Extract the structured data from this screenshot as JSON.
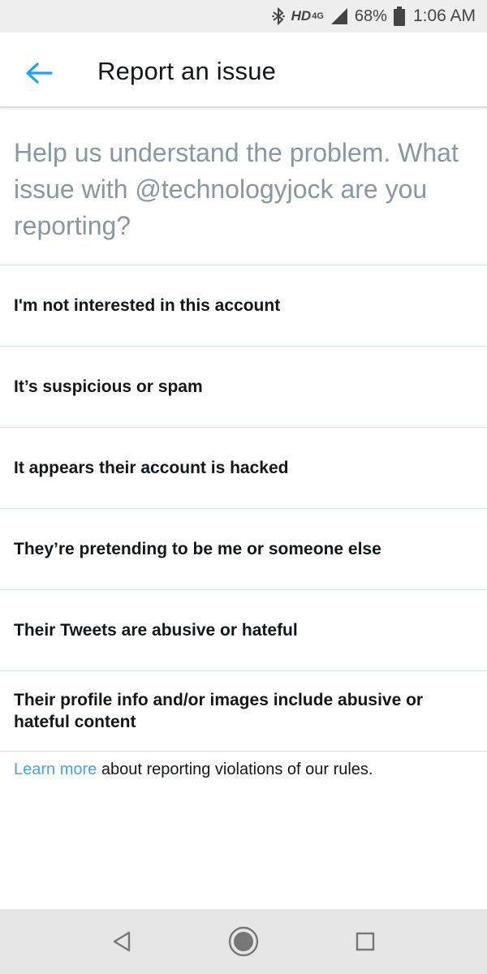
{
  "status_bar": {
    "network": "HD",
    "network_type": "4G",
    "battery": "68%",
    "time": "1:06 AM",
    "icons": [
      "bluetooth-icon",
      "signal-icon",
      "battery-icon"
    ]
  },
  "header": {
    "title": "Report an issue",
    "back_icon": "arrow-left-icon",
    "accent_color": "#1da1f2"
  },
  "prompt": "Help us understand the problem. What issue with @technologyjock are you reporting?",
  "options": [
    {
      "label": "I'm not interested in this account"
    },
    {
      "label": "It’s suspicious or spam"
    },
    {
      "label": "It appears their account is hacked"
    },
    {
      "label": "They’re pretending to be me or someone else"
    },
    {
      "label": "Their Tweets are abusive or hateful"
    },
    {
      "label": "Their profile info and/or images include abusive or hateful content"
    }
  ],
  "footer": {
    "link_text": "Learn more",
    "text": " about reporting violations of our rules."
  },
  "nav_bar": {
    "icons": [
      "back-triangle-icon",
      "home-circle-icon",
      "recents-square-icon"
    ]
  }
}
